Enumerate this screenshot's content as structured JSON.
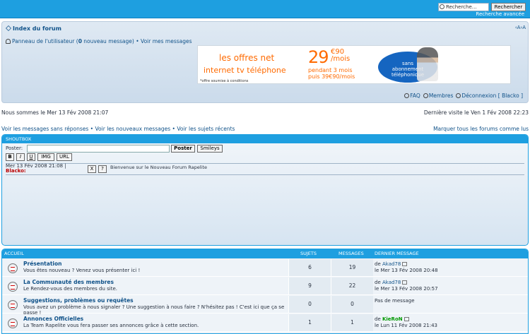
{
  "search": {
    "placeholder": "Recherche…",
    "button": "Rechercher",
    "advanced": "Recherche avancée"
  },
  "header": {
    "index": "Index du forum",
    "resize": "‹A›A",
    "ucp_prefix": "Panneau de l'utilisateur (",
    "ucp_count": "0",
    "ucp_suffix": " nouveau message) •",
    "view_messages": "Voir mes messages"
  },
  "ad": {
    "line1": "les offres net",
    "line2": "internet  tv  téléphone",
    "price": "29",
    "cents": "€90",
    "per": "/mois",
    "line3a": "pendant 3 mois",
    "line3b": "puis 39€90/mois",
    "note": "*offre soumise à conditions",
    "badge1": "sans",
    "badge2": "abonnement",
    "badge3": "téléphonique"
  },
  "quick": {
    "faq": "FAQ",
    "members": "Membres",
    "logout": "Déconnexion [ Blacko ]"
  },
  "info": {
    "now": "Nous sommes le Mer 13 Fév 2008 21:07",
    "last": "Dernière visite le Ven 1 Fév 2008 22:23"
  },
  "links": {
    "noreply": "Voir les messages sans réponses",
    "newmsgs": "Voir les nouveaux messages",
    "recent": "Voir les sujets récents",
    "markall": "Marquer tous les forums comme lus",
    "sep": " • "
  },
  "shoutbox": {
    "title": "SHOUTBOX",
    "poster_label": "Poster:",
    "post_btn": "Poster",
    "smileys_btn": "Smileys",
    "format": [
      "B",
      "I",
      "U",
      "IMG",
      "URL"
    ],
    "entry": {
      "date": "Mer 13 Fév 2008 21:08 |",
      "nick": "Blacko:",
      "x": "X",
      "q": "?",
      "text": "Bienvenue sur le Nouveau Forum Rapelite"
    }
  },
  "forum": {
    "headers": {
      "home": "ACCUEIL",
      "topics": "SUJETS",
      "messages": "MESSAGES",
      "last": "DERNIER MESSAGE"
    },
    "rows": [
      {
        "title": "Présentation",
        "desc": "Vous êtes nouveau ? Venez vous présenter ici !",
        "topics": "6",
        "posts": "19",
        "by": "de ",
        "author": "Akad78",
        "date": "le Mer 13 Fév 2008 20:48"
      },
      {
        "title": "La Communauté des membres",
        "desc": "Le Rendez-vous des membres du site.",
        "topics": "9",
        "posts": "22",
        "by": "de ",
        "author": "Akad78",
        "date": "le Mer 13 Fév 2008 20:57"
      },
      {
        "title": "Suggestions, problèmes ou requêtes",
        "desc": "Vous avez un problème à nous signaler ? Une suggestion à nous faire ? N'hésitez pas ! C'est ici que ça se passe !",
        "topics": "0",
        "posts": "0",
        "by": "",
        "author": "Pas de message",
        "date": ""
      },
      {
        "title": "Annonces Officielles",
        "desc": "La Team Rapelite vous fera passer ses annonces grâce à cette section.",
        "topics": "1",
        "posts": "1",
        "by": "de ",
        "author": "KieRoN",
        "date": "le Lun 11 Fév 2008 21:43"
      }
    ]
  },
  "colors": {
    "accent": "#1e9fe0",
    "link": "#105289",
    "admin": "#009900"
  }
}
